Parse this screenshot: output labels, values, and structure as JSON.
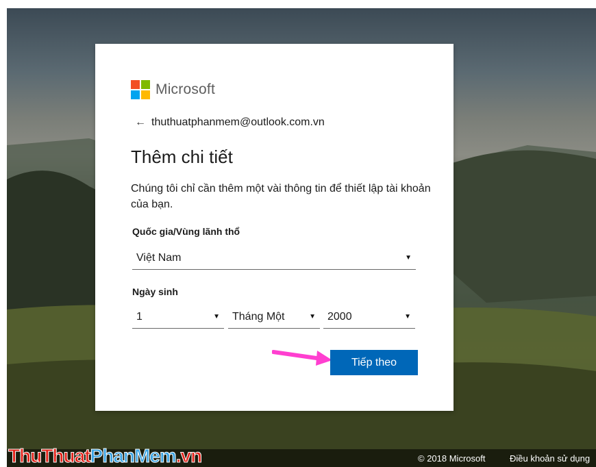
{
  "brand": {
    "name": "Microsoft",
    "logo_colors": [
      "#f25022",
      "#7fba00",
      "#00a4ef",
      "#ffb900"
    ]
  },
  "account": {
    "email": "thuthuatphanmem@outlook.com.vn",
    "back_icon": "arrow-left-icon"
  },
  "form": {
    "title": "Thêm chi tiết",
    "description": "Chúng tôi chỉ cần thêm một vài thông tin để thiết lập tài khoản của bạn.",
    "country_label": "Quốc gia/Vùng lãnh thổ",
    "country_value": "Việt Nam",
    "dob_label": "Ngày sinh",
    "day_value": "1",
    "month_value": "Tháng Một",
    "year_value": "2000",
    "caret_glyph": "▼",
    "next_label": "Tiếp theo",
    "accent_color": "#0067b8"
  },
  "annotation": {
    "arrow_color": "#ff3fd0"
  },
  "footer": {
    "copyright": "© 2018 Microsoft",
    "terms": "Điều khoản sử dụng"
  },
  "watermark": {
    "part1": "ThuThuat",
    "part2": "PhanMem",
    "part3": ".vn"
  }
}
